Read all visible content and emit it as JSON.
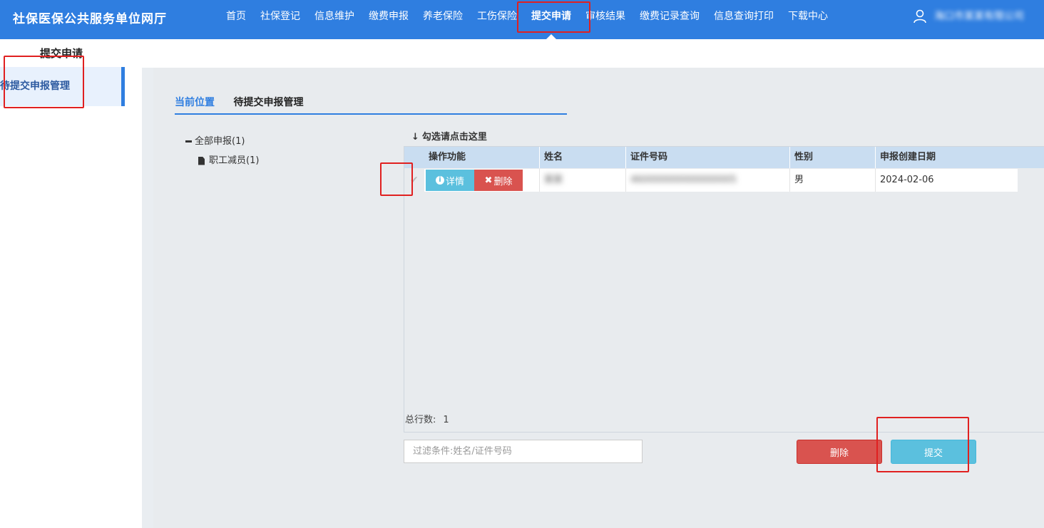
{
  "header": {
    "brand": "社保医保公共服务单位网厅",
    "nav": [
      "首页",
      "社保登记",
      "信息维护",
      "缴费申报",
      "养老保险",
      "工伤保险",
      "提交申请",
      "审核结果",
      "缴费记录查询",
      "信息查询打印",
      "下载中心"
    ],
    "active_nav": "提交申请",
    "user_name": "海口市某某有限公司"
  },
  "sidebar": {
    "title": "提交申请",
    "items": [
      {
        "label": "待提交申报管理",
        "active": true
      }
    ]
  },
  "breadcrumb": {
    "label": "当前位置",
    "current": "待提交申报管理"
  },
  "tree": {
    "root": "全部申报(1)",
    "children": [
      "职工减员(1)"
    ]
  },
  "grid": {
    "hint": "勾选请点击这里",
    "columns": [
      "操作功能",
      "姓名",
      "证件号码",
      "性别",
      "申报创建日期"
    ],
    "rows": [
      {
        "name": "某某",
        "id_number": "460000000000000005",
        "gender": "男",
        "created": "2024-02-06"
      }
    ],
    "detail_label": "详情",
    "delete_label": "删除",
    "total_label": "总行数:",
    "total_count": "1"
  },
  "footer": {
    "filter_placeholder": "过滤条件:姓名/证件号码",
    "delete_button": "删除",
    "submit_button": "提交"
  },
  "colors": {
    "primary": "#2f7ee0",
    "danger": "#d9534f",
    "info": "#5bc0de",
    "highlight": "#e02020"
  }
}
